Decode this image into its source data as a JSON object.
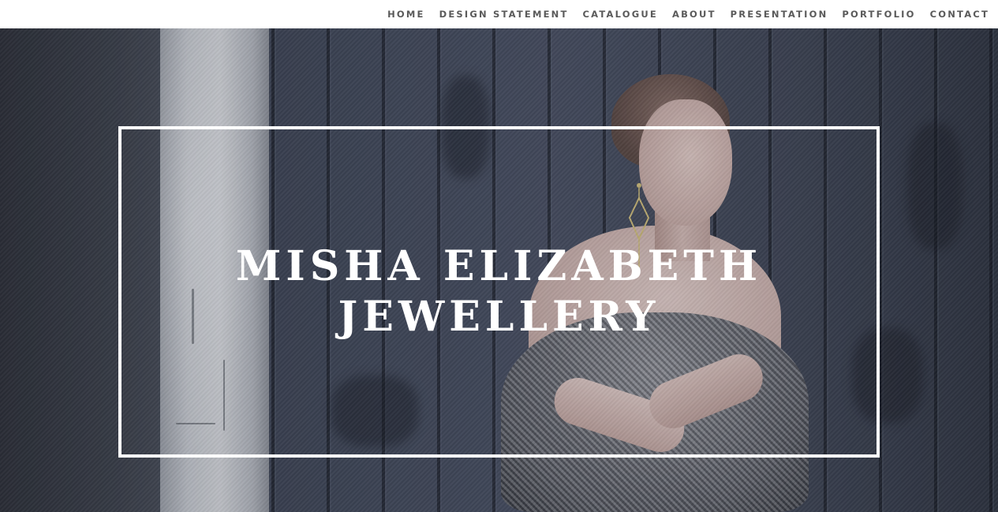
{
  "nav": {
    "items": [
      {
        "label": "HOME"
      },
      {
        "label": "DESIGN STATEMENT"
      },
      {
        "label": "CATALOGUE"
      },
      {
        "label": "ABOUT"
      },
      {
        "label": "PRESENTATION"
      },
      {
        "label": "PORTFOLIO"
      },
      {
        "label": "CONTACT"
      }
    ]
  },
  "hero": {
    "title_line_1": "MISHA ELIZABETH",
    "title_line_2": "JEWELLERY",
    "frame_color": "#ffffff",
    "background_color": "#3b4150"
  },
  "colors": {
    "nav_text": "#5a5a5a",
    "nav_background": "#ffffff",
    "title_text": "#ffffff"
  }
}
